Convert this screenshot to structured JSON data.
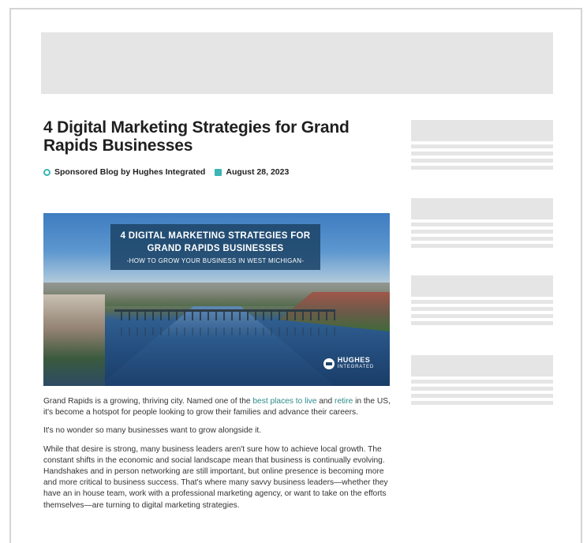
{
  "article": {
    "title": "4 Digital Marketing Strategies for Grand Rapids Businesses",
    "author": "Sponsored Blog by Hughes Integrated",
    "date": "August 28, 2023"
  },
  "hero": {
    "overlay_title_line1": "4 DIGITAL MARKETING STRATEGIES FOR",
    "overlay_title_line2": "GRAND RAPIDS BUSINESSES",
    "overlay_subtitle": "-HOW TO GROW YOUR BUSINESS IN WEST MICHIGAN-",
    "logo_line1": "HUGHES",
    "logo_line2": "INTEGRATED"
  },
  "body": {
    "p1_a": "Grand Rapids is a growing, thriving city. Named one of the ",
    "p1_link1": "best places to live",
    "p1_b": " and ",
    "p1_link2": "retire",
    "p1_c": " in the US, it's become a hotspot for people looking to grow their families and advance their careers.",
    "p2": "It's no wonder so many businesses want to grow alongside it.",
    "p3": "While that desire is strong, many business leaders aren't sure how to achieve local growth. The constant shifts in the economic and social landscape mean that business is continually evolving. Handshakes and in person networking are still important, but online presence is becoming more and more critical to business success. That's where many savvy business leaders—whether they have an in house team, work with a professional marketing agency, or want to take on the efforts themselves—are turning to digital marketing strategies."
  },
  "colors": {
    "accent": "#3bb5b5",
    "placeholder": "#e5e5e6",
    "link": "#2d8a8a"
  },
  "icons": {
    "author": "user-icon",
    "date": "calendar-icon",
    "logo": "hughes-logo-icon"
  }
}
